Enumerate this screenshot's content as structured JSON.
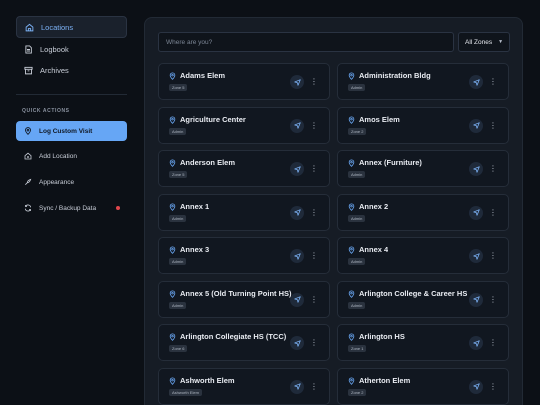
{
  "sidebar": {
    "nav": [
      {
        "label": "Locations",
        "icon": "home-icon",
        "active": true
      },
      {
        "label": "Logbook",
        "icon": "file-icon",
        "active": false
      },
      {
        "label": "Archives",
        "icon": "archive-icon",
        "active": false
      }
    ],
    "quick_actions_title": "QUICK ACTIONS",
    "actions": [
      {
        "label": "Log Custom Visit",
        "icon": "map-pin-icon",
        "primary": true
      },
      {
        "label": "Add Location",
        "icon": "home-plus-icon",
        "primary": false
      },
      {
        "label": "Appearance",
        "icon": "palette-icon",
        "primary": false
      },
      {
        "label": "Sync / Backup Data",
        "icon": "sync-icon",
        "primary": false,
        "alert": true
      }
    ]
  },
  "main": {
    "search_placeholder": "Where are you?",
    "zone_filter": "All Zones",
    "locations": [
      {
        "name": "Adams Elem",
        "tag": "Zone 5"
      },
      {
        "name": "Administration Bldg",
        "tag": "Admin"
      },
      {
        "name": "Agriculture Center",
        "tag": "Admin"
      },
      {
        "name": "Amos Elem",
        "tag": "Zone 2"
      },
      {
        "name": "Anderson Elem",
        "tag": "Zone 5"
      },
      {
        "name": "Annex (Furniture)",
        "tag": "Admin"
      },
      {
        "name": "Annex 1",
        "tag": "Admin"
      },
      {
        "name": "Annex 2",
        "tag": "Admin"
      },
      {
        "name": "Annex 3",
        "tag": "Admin"
      },
      {
        "name": "Annex 4",
        "tag": "Admin"
      },
      {
        "name": "Annex 5 (Old Turning Point HS)",
        "tag": "Admin"
      },
      {
        "name": "Arlington College & Career HS",
        "tag": "Admin"
      },
      {
        "name": "Arlington Collegiate HS (TCC)",
        "tag": "Zone 6"
      },
      {
        "name": "Arlington HS",
        "tag": "Zone 1"
      },
      {
        "name": "Ashworth Elem",
        "tag": "Ashworth Elem"
      },
      {
        "name": "Atherton Elem",
        "tag": "Zone 2"
      }
    ]
  },
  "colors": {
    "accent": "#66a6f5",
    "background": "#0c1016",
    "panel": "#161c25",
    "card": "#111720",
    "alert": "#e0474c"
  }
}
